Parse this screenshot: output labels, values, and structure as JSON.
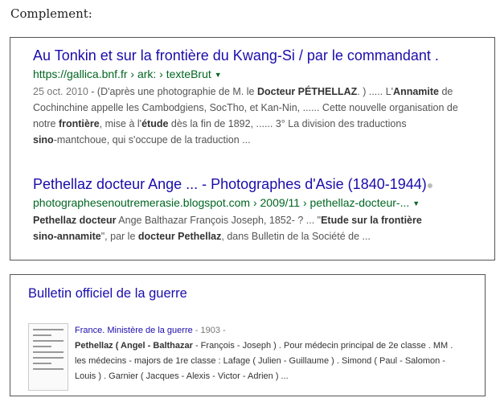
{
  "heading": "Complement:",
  "results": [
    {
      "title": "Au Tonkin et sur la frontière du Kwang-Si / par le commandant .",
      "url": "https://gallica.bnf.fr › ark: › texteBrut",
      "snippet": {
        "date": "25 oct. 2010",
        "l1a": " - (D'après une photographie de M. le ",
        "l1b": "Docteur PÉTHELLAZ",
        "l1c": ". ) ..... L'",
        "l1d": "Annamite",
        "l1e": " de",
        "l2": "Cochinchine appelle les Cambodgiens, SocTho, et Kan-Nin, ...... Cette nouvelle organisation de",
        "l3a": "notre ",
        "l3b": "frontière",
        "l3c": ", mise à l'",
        "l3d": "étude",
        "l3e": " dès la fin de 1892, ...... 3° La division des traductions",
        "l4a": "sino",
        "l4b": "-mantchoue, qui s'occupe de la traduction ..."
      }
    },
    {
      "title": "Pethellaz docteur Ange ... - Photographes d'Asie (1840-1944)",
      "url": "photographesenoutremerasie.blogspot.com › 2009/11 › pethellaz-docteur-...",
      "snippet": {
        "l1a": "Pethellaz docteur",
        "l1b": " Ange Balthazar François Joseph, 1852- ? ... \"",
        "l1c": "Etude sur la frontière",
        "l2a": "sino-annamite",
        "l2b": "\", par le ",
        "l2c": "docteur Pethellaz",
        "l2d": ", dans Bulletin de la Société de ..."
      }
    }
  ],
  "books": {
    "title": "Bulletin officiel de la guerre",
    "source": "France. Ministère de la guerre",
    "year": " - 1903 -",
    "l1a": "Pethellaz ( Angel - Balthazar",
    "l1b": " - François - Joseph ) . Pour médecin principal de 2e classe . MM .",
    "l2": "les médecins - majors de 1re classe : Lafage ( Julien - Guillaume ) . Simond ( Paul - Salomon -",
    "l3": "Louis ) . Garnier ( Jacques - Alexis - Victor - Adrien ) ..."
  }
}
